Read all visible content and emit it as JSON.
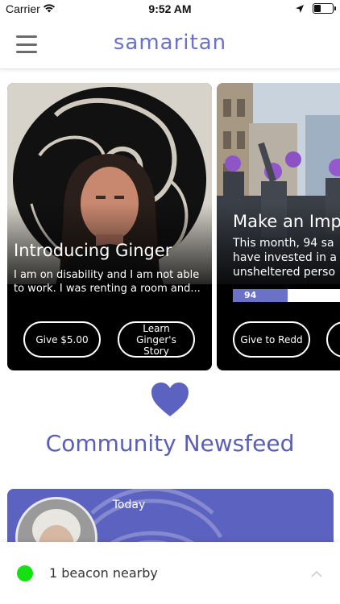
{
  "status_bar": {
    "carrier": "Carrier",
    "time": "9:52 AM",
    "battery_level": 0.35
  },
  "header": {
    "title": "samaritan",
    "menu_icon": "hamburger-menu-icon"
  },
  "cards": [
    {
      "title": "Introducing Ginger",
      "text": "I am on disability and I am not able to work.  I was renting a room and...",
      "primary_button": "Give $5.00",
      "secondary_button": "Learn Ginger's Story"
    },
    {
      "title": "Make an Imp",
      "text_line1": "This month, 94 sa",
      "text_line2": "have invested in a",
      "text_line3": "unsheltered perso",
      "progress_label": "94",
      "progress_fraction": 0.45,
      "primary_button": "Give to Redd"
    }
  ],
  "section": {
    "heading": "Community Newsfeed",
    "icon": "heart-icon"
  },
  "feed": {
    "date_label": "Today"
  },
  "beacon": {
    "status_text": "1 beacon nearby",
    "status_color": "#14e014"
  },
  "colors": {
    "brand": "#6b70c9",
    "feed_card": "#5c62c0"
  }
}
